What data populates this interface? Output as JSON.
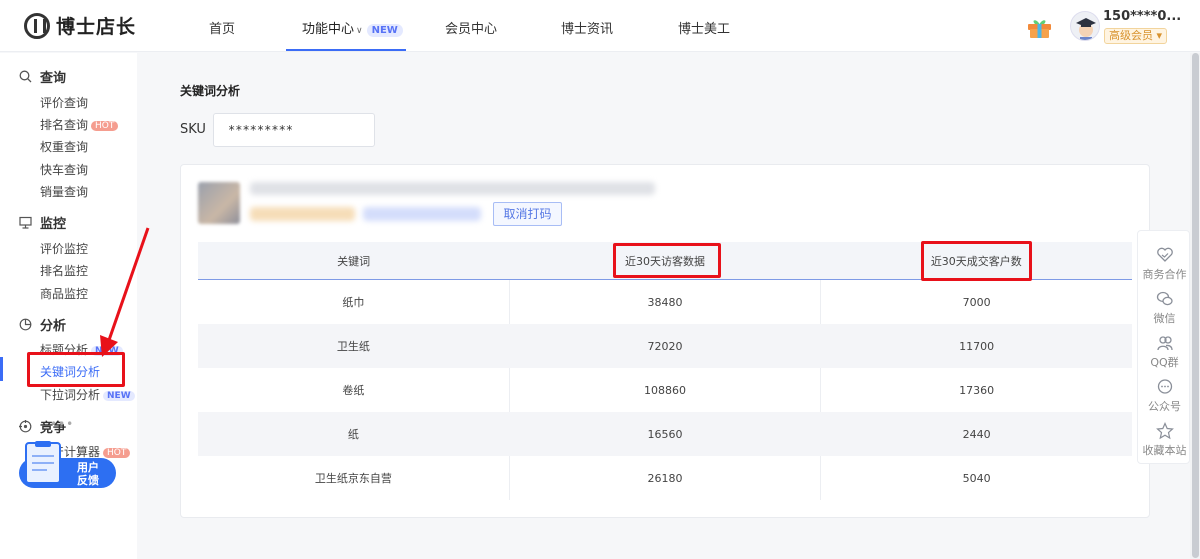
{
  "brand": {
    "name": "博士店长"
  },
  "topnav": {
    "items": [
      {
        "label": "首页"
      },
      {
        "label": "功能中心",
        "badge": "NEW"
      },
      {
        "label": "会员中心"
      },
      {
        "label": "博士资讯"
      },
      {
        "label": "博士美工"
      }
    ]
  },
  "user": {
    "name": "150****0...",
    "level": "高级会员"
  },
  "sidebar": {
    "groups": [
      {
        "label": "查询",
        "icon": "search-icon",
        "items": [
          {
            "label": "评价查询"
          },
          {
            "label": "排名查询",
            "badge": "HOT"
          },
          {
            "label": "权重查询"
          },
          {
            "label": "快车查询"
          },
          {
            "label": "销量查询"
          }
        ]
      },
      {
        "label": "监控",
        "icon": "monitor-icon",
        "items": [
          {
            "label": "评价监控"
          },
          {
            "label": "排名监控"
          },
          {
            "label": "商品监控"
          }
        ]
      },
      {
        "label": "分析",
        "icon": "pie-icon",
        "items": [
          {
            "label": "标题分析",
            "badge": "NEW"
          },
          {
            "label": "关键词分析",
            "active": true
          },
          {
            "label": "下拉词分析",
            "badge": "NEW"
          }
        ]
      },
      {
        "label": "竞争",
        "icon": "target-icon",
        "items": [
          {
            "label": "坑产计算器",
            "badge": "HOT"
          }
        ]
      }
    ],
    "more": "•••",
    "feedback": {
      "line1": "用户",
      "line2": "反馈"
    }
  },
  "main": {
    "title": "关键词分析",
    "sku": {
      "label": "SKU",
      "value": "*********"
    },
    "unmask_button": "取消打码",
    "table": {
      "columns": [
        "关键词",
        "近30天访客数据",
        "近30天成交客户数"
      ],
      "rows": [
        {
          "keyword": "纸巾",
          "visitors": "38480",
          "buyers": "7000"
        },
        {
          "keyword": "卫生纸",
          "visitors": "72020",
          "buyers": "11700"
        },
        {
          "keyword": "卷纸",
          "visitors": "108860",
          "buyers": "17360"
        },
        {
          "keyword": "纸",
          "visitors": "16560",
          "buyers": "2440"
        },
        {
          "keyword": "卫生纸京东自营",
          "visitors": "26180",
          "buyers": "5040"
        }
      ]
    }
  },
  "floatbar": {
    "items": [
      {
        "label": "商务合作",
        "icon": "handshake-icon"
      },
      {
        "label": "微信",
        "icon": "wechat-icon"
      },
      {
        "label": "QQ群",
        "icon": "group-icon"
      },
      {
        "label": "公众号",
        "icon": "chat-bubble-icon"
      },
      {
        "label": "收藏本站",
        "icon": "star-icon"
      }
    ]
  },
  "colors": {
    "accent": "#3b6cf6",
    "highlight": "#e8111a"
  }
}
